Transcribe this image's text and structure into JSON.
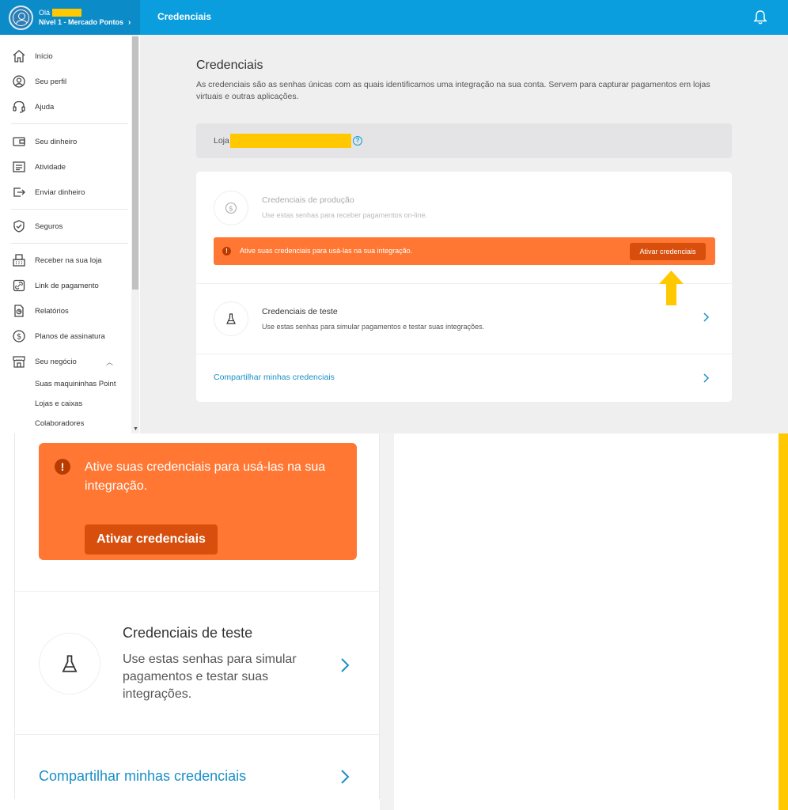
{
  "header": {
    "greeting": "Olá",
    "level": "Nível 1 - Mercado Pontos",
    "title": "Credenciais",
    "bell_icon": "bell-icon"
  },
  "sidebar": {
    "items": [
      {
        "label": "Início",
        "icon": "home-icon"
      },
      {
        "label": "Seu perfil",
        "icon": "profile-icon"
      },
      {
        "label": "Ajuda",
        "icon": "headset-icon"
      },
      {
        "label": "Seu dinheiro",
        "icon": "wallet-icon"
      },
      {
        "label": "Atividade",
        "icon": "list-icon"
      },
      {
        "label": "Enviar dinheiro",
        "icon": "send-icon"
      },
      {
        "label": "Seguros",
        "icon": "shield-icon"
      },
      {
        "label": "Receber na sua loja",
        "icon": "pos-icon"
      },
      {
        "label": "Link de pagamento",
        "icon": "link-icon"
      },
      {
        "label": "Relatórios",
        "icon": "report-icon"
      },
      {
        "label": "Planos de assinatura",
        "icon": "dollar-icon"
      },
      {
        "label": "Seu negócio",
        "icon": "store-icon"
      }
    ],
    "subitems": [
      "Suas maquininhas Point",
      "Lojas e caixas",
      "Colaboradores"
    ]
  },
  "main": {
    "title": "Credenciais",
    "description": "As credenciais são as senhas únicas com as quais identificamos uma integração na sua conta. Servem para capturar pagamentos em lojas virtuais e outras aplicações.",
    "store_label": "Loja",
    "help_glyph": "?",
    "production": {
      "title": "Credenciais de produção",
      "description": "Use estas senhas para receber pagamentos on-line."
    },
    "alert": {
      "icon_glyph": "!",
      "text": "Ative suas credenciais para usá-las na sua integração.",
      "button": "Ativar credenciais"
    },
    "test": {
      "title": "Credenciais de teste",
      "description": "Use estas senhas para simular pagamentos e testar suas integrações."
    },
    "share_link": "Compartilhar minhas credenciais"
  },
  "zoom": {
    "alert_text": "Ative suas credenciais para usá-las na sua integração.",
    "alert_button": "Ativar credenciais",
    "test_title": "Credenciais de teste",
    "test_description": "Use estas senhas para simular pagamentos e testar suas integrações.",
    "share_link": "Compartilhar minhas credenciais"
  },
  "colors": {
    "header_blue": "#0a9edf",
    "account_blue": "#0b8bc7",
    "alert_orange": "#ff7733",
    "button_orange": "#d84f0d",
    "link_blue": "#1a8fc7",
    "highlight_yellow": "#ffc800"
  }
}
